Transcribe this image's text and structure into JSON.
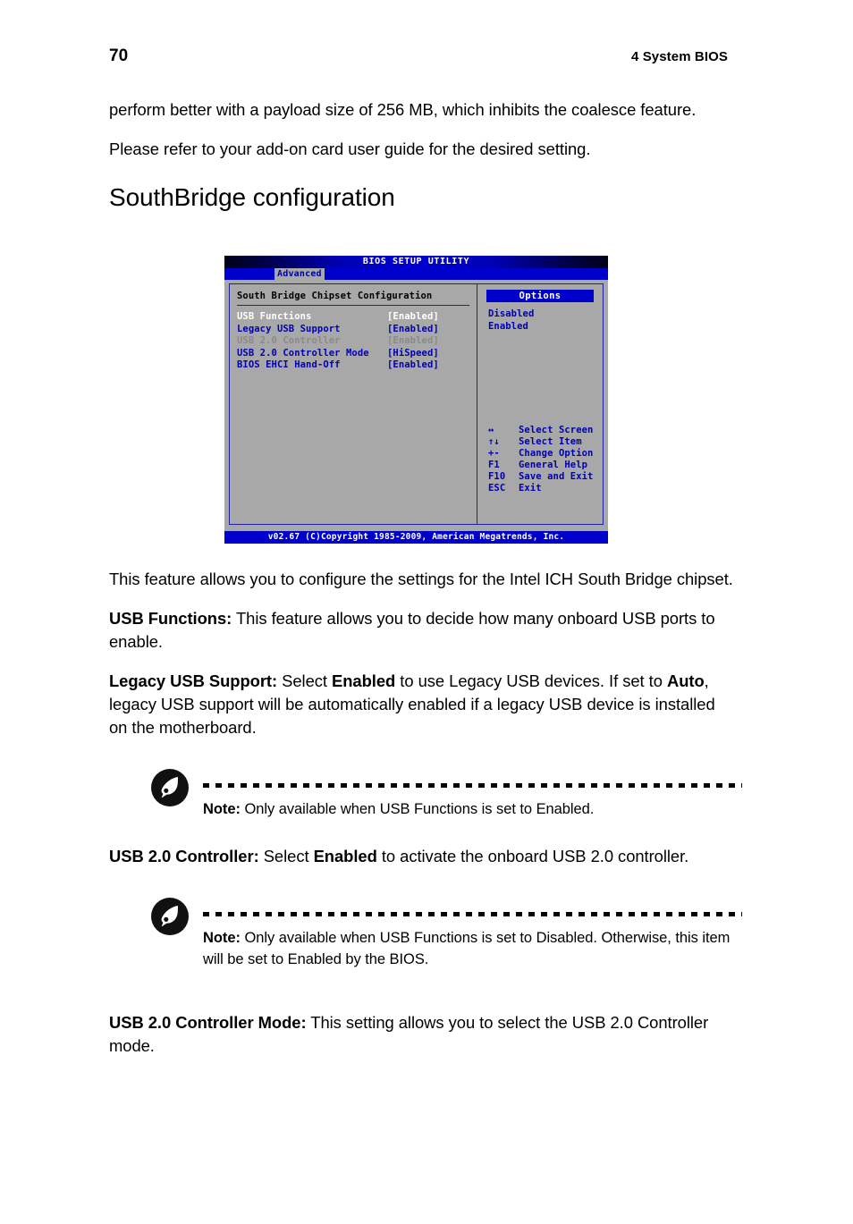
{
  "header": {
    "page_number": "70",
    "chapter": "4 System BIOS"
  },
  "body": {
    "para_intro_1": "perform better with a payload size of 256 MB, which inhibits the coalesce feature.",
    "para_intro_2": "Please refer to your add-on card user guide for the desired setting.",
    "section_title": "SouthBridge configuration",
    "para_after_image": "This feature allows you to configure the settings for the Intel ICH South Bridge chipset.",
    "usb_functions_term": "USB Functions:",
    "usb_functions_desc": " This feature allows you to decide how many onboard USB ports to enable.",
    "legacy_usb_term": "Legacy USB Support:",
    "legacy_usb_desc_1": " Select ",
    "legacy_usb_bold_enabled": "Enabled",
    "legacy_usb_desc_2": " to use Legacy USB devices. If set to ",
    "legacy_usb_bold_auto": "Auto",
    "legacy_usb_desc_3": ", legacy USB support will be automatically enabled if a legacy USB device is installed on the motherboard.",
    "usb20_controller_term": "USB 2.0 Controller:",
    "usb20_controller_desc_1": " Select ",
    "usb20_controller_bold_enabled": "Enabled",
    "usb20_controller_desc_2": " to activate the onboard USB 2.0 controller.",
    "usb20_mode_term": "USB 2.0 Controller Mode:",
    "usb20_mode_desc": " This setting allows you to select the USB 2.0 Controller mode."
  },
  "notes": [
    {
      "icon": "acer-note-icon",
      "label": "Note:",
      "text": " Only available when USB Functions is set to Enabled."
    },
    {
      "icon": "acer-note-icon",
      "label": "Note:",
      "text": " Only available when USB Functions is set to Disabled. Otherwise, this item will be set to Enabled by the BIOS."
    }
  ],
  "bios": {
    "title": "BIOS SETUP UTILITY",
    "active_tab": "Advanced",
    "pane_heading": "South Bridge Chipset Configuration",
    "rows": [
      {
        "label": "USB Functions",
        "value": "[Enabled]",
        "state": "sel"
      },
      {
        "label": "Legacy USB Support",
        "value": "[Enabled]",
        "state": "norm"
      },
      {
        "label": "USB 2.0 Controller",
        "value": "[Enabled]",
        "state": "dim"
      },
      {
        "label": "USB 2.0 Controller Mode",
        "value": "[HiSpeed]",
        "state": "norm"
      },
      {
        "label": "BIOS EHCI Hand-Off",
        "value": "[Enabled]",
        "state": "norm"
      }
    ],
    "options_title": "Options",
    "options": [
      "Disabled",
      "Enabled"
    ],
    "keyhelp": [
      {
        "key": "↔",
        "action": "Select Screen"
      },
      {
        "key": "↑↓",
        "action": "Select Item"
      },
      {
        "key": "+-",
        "action": "Change Option"
      },
      {
        "key": "F1",
        "action": "General Help"
      },
      {
        "key": "F10",
        "action": "Save and Exit"
      },
      {
        "key": "ESC",
        "action": "Exit"
      }
    ],
    "footer": "v02.67 (C)Copyright 1985-2009, American Megatrends, Inc.",
    "colors": {
      "screen_bg": "#a8a8a8",
      "accent_blue": "#0000cc",
      "text_blue": "#0000b0",
      "dim_gray": "#8a8a8a",
      "selected_white": "#ffffff"
    }
  }
}
